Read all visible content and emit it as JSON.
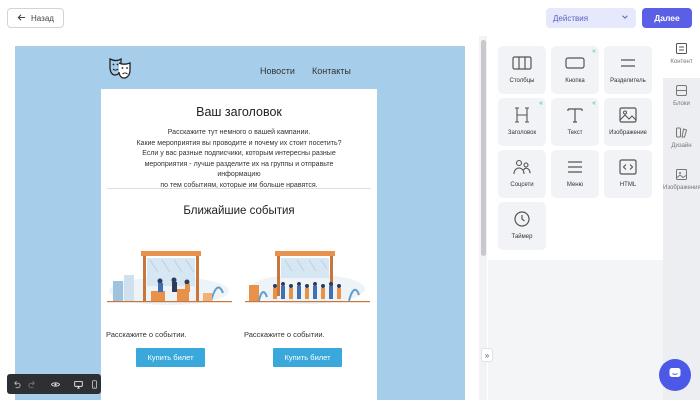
{
  "header": {
    "back_label": "Назад",
    "actions_label": "Действия",
    "next_label": "Далее"
  },
  "email": {
    "nav": [
      "Новости",
      "Контакты"
    ],
    "title": "Ваш заголовок",
    "intro_lines": [
      "Расскажите тут немного о вашей кампании.",
      "Какие мероприятия вы проводите и почему их стоит посетить?",
      "Если у вас разные подписчики, которым интересны разные",
      "мероприятия - лучше разделите их на группы и отправьте информацию",
      "по тем событиям, которые им больше нравятся."
    ],
    "events_title": "Ближайшие события",
    "events": [
      {
        "text": "Расскажите о событии.",
        "button": "Купить билет"
      },
      {
        "text": "Расскажите о событии.",
        "button": "Купить билет"
      }
    ]
  },
  "blocks": [
    {
      "label": "Столбцы",
      "icon": "columns-icon",
      "chevron": false
    },
    {
      "label": "Кнопка",
      "icon": "button-icon",
      "chevron": true
    },
    {
      "label": "Разделитель",
      "icon": "divider-icon",
      "chevron": false
    },
    {
      "label": "Заголовок",
      "icon": "heading-icon",
      "chevron": true
    },
    {
      "label": "Текст",
      "icon": "text-icon",
      "chevron": true
    },
    {
      "label": "Изображение",
      "icon": "image-icon",
      "chevron": false
    },
    {
      "label": "Соцсети",
      "icon": "social-icon",
      "chevron": false
    },
    {
      "label": "Меню",
      "icon": "menu-icon",
      "chevron": false
    },
    {
      "label": "HTML",
      "icon": "html-icon",
      "chevron": false
    },
    {
      "label": "Таймер",
      "icon": "timer-icon",
      "chevron": false
    }
  ],
  "sidebar": {
    "items": [
      {
        "label": "Контент",
        "icon": "content-icon",
        "active": true
      },
      {
        "label": "Блоки",
        "icon": "blocks-icon",
        "active": false
      },
      {
        "label": "Дизайн",
        "icon": "design-icon",
        "active": false
      },
      {
        "label": "Изображения",
        "icon": "images-icon",
        "active": false
      }
    ]
  },
  "colors": {
    "accent": "#5b5fe6",
    "canvas_bg": "#a6cde9",
    "ticket_button": "#3aa8da",
    "chevron": "#3fc49a"
  }
}
